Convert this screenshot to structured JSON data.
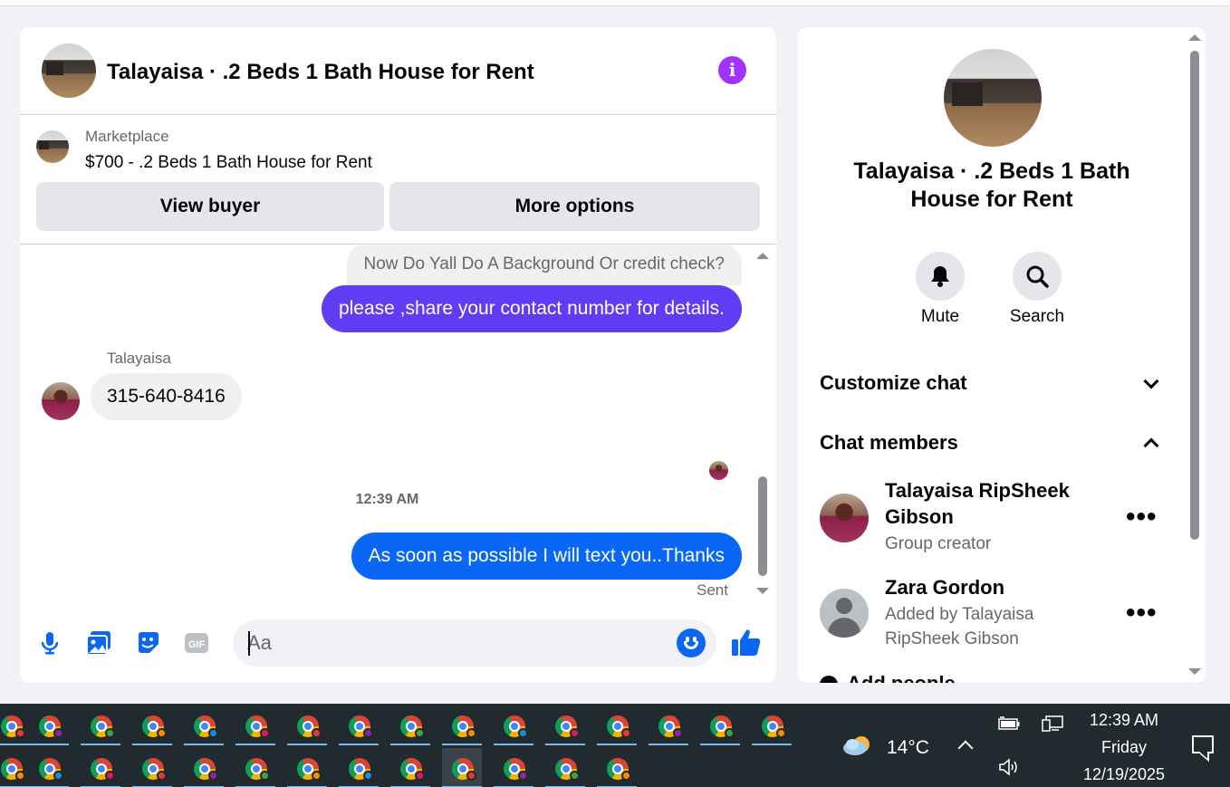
{
  "chat": {
    "title": "Talayaisa · .2 Beds 1 Bath House for Rent",
    "marketplace_label": "Marketplace",
    "listing": "$700 - .2 Beds 1 Bath House for Rent",
    "view_buyer": "View buyer",
    "more_options": "More options",
    "messages": {
      "quoted": "Now Do Yall Do A Background Or credit check?",
      "sent_1": "please ,share your contact  number for details.",
      "sender_name": "Talayaisa",
      "received_1": "315-640-8416",
      "timestamp": "12:39 AM",
      "sent_2": "As soon as possible I will text you..Thanks",
      "status": "Sent"
    },
    "composer": {
      "placeholder": "Aa"
    },
    "icons": [
      "info-icon",
      "microphone-icon",
      "photo-icon",
      "sticker-icon",
      "gif-icon",
      "emoji-icon",
      "thumbs-up-icon"
    ],
    "colors": {
      "accent": "#0a66f5",
      "sent_bubble_purple": "#5f3df5",
      "info": "#a033ff"
    }
  },
  "info": {
    "title": "Talayaisa · .2 Beds 1 Bath House for Rent",
    "mute": "Mute",
    "search": "Search",
    "customize_chat": "Customize chat",
    "chat_members": "Chat members",
    "members": [
      {
        "name": "Talayaisa RipSheek Gibson",
        "role": "Group creator"
      },
      {
        "name": "Zara Gordon",
        "role": "Added by Talayaisa RipSheek Gibson"
      }
    ],
    "add_people": "Add people"
  },
  "taskbar": {
    "temperature": "14°C",
    "time": "12:39 AM",
    "day": "Friday",
    "date": "12/19/2025"
  }
}
